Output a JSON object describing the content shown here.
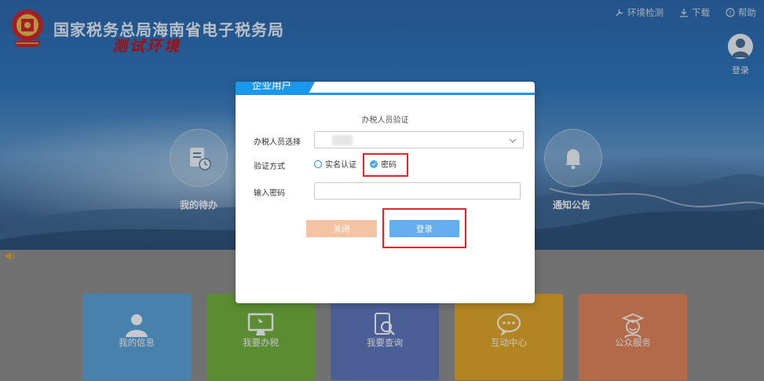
{
  "header": {
    "site_title": "国家税务总局海南省电子税务局",
    "test_env_label": "测试环境"
  },
  "toplinks": [
    {
      "label": "环境检测",
      "icon": "wrench-icon"
    },
    {
      "label": "下载",
      "icon": "download-icon"
    },
    {
      "label": "帮助",
      "icon": "help-icon"
    }
  ],
  "user": {
    "login_label": "登录"
  },
  "quick_links": {
    "todo": "我的待办",
    "notice": "通知公告"
  },
  "tiles": [
    {
      "label": "我的信息",
      "icon": "user-icon",
      "color": "#5a9ed3"
    },
    {
      "label": "我要办税",
      "icon": "monitor-icon",
      "color": "#6fab3e"
    },
    {
      "label": "我要查询",
      "icon": "search-doc-icon",
      "color": "#5d73b7"
    },
    {
      "label": "互动中心",
      "icon": "chat-icon",
      "color": "#d9a32a"
    },
    {
      "label": "公众服务",
      "icon": "service-icon",
      "color": "#d98258"
    }
  ],
  "modal": {
    "tab_label": "企业用户",
    "subtitle": "办税人员验证",
    "person_label": "办税人员选择",
    "method_label": "验证方式",
    "method_options": [
      "实名认证",
      "密码"
    ],
    "method_selected": "密码",
    "password_label": "输入密码",
    "password_value": "",
    "close_button": "关闭",
    "login_button": "登录"
  },
  "colors": {
    "accent": "#1a98ee",
    "login_button": "#64adee",
    "close_button": "#f3c3a3",
    "highlight": "#e0262a"
  }
}
